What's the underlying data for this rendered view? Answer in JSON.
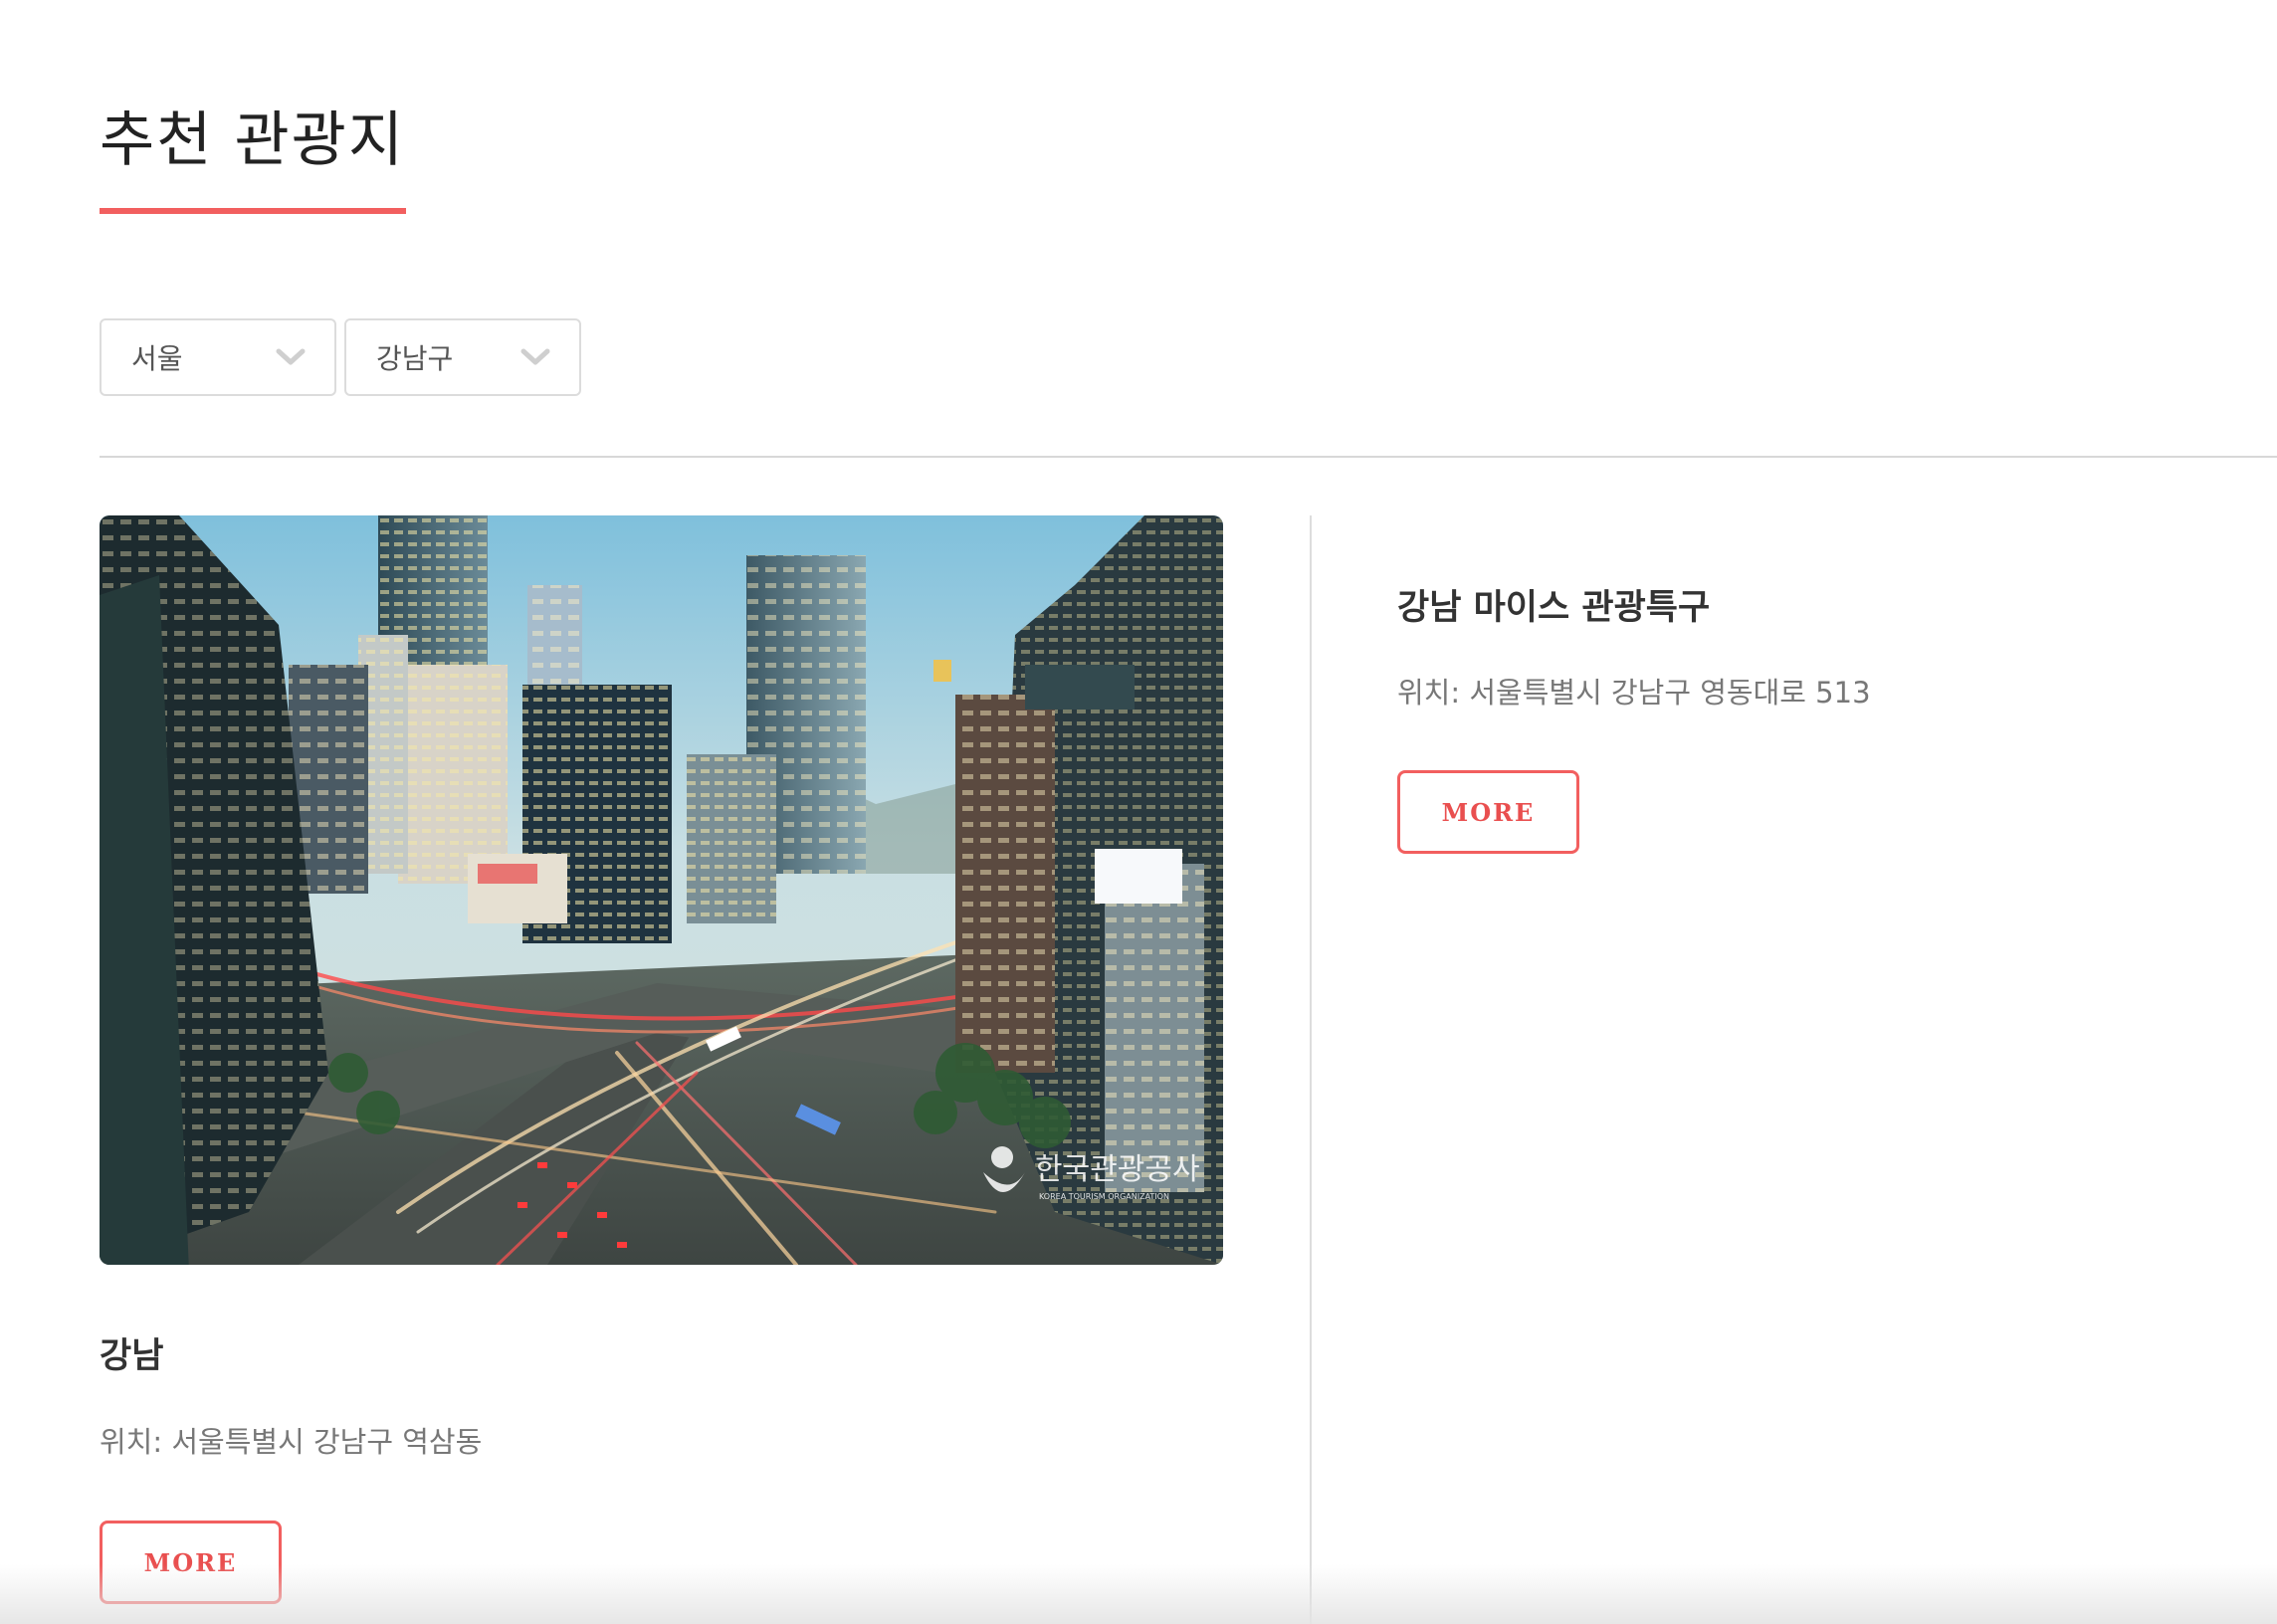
{
  "page": {
    "title": "추천 관광지",
    "accent_color": "#f25f5f"
  },
  "filters": {
    "region": {
      "value": "서울"
    },
    "district": {
      "value": "강남구"
    }
  },
  "cards": [
    {
      "title": "강남",
      "location": "위치: 서울특별시 강남구 역삼동",
      "button": "MORE",
      "image": {
        "description_icon": "city-photo",
        "watermark_korean": "한국관광공사",
        "watermark_english": "KOREA TOURISM ORGANIZATION"
      }
    },
    {
      "title": "강남 마이스 관광특구",
      "location": "위치: 서울특별시 강남구 영동대로 513",
      "button": "MORE"
    }
  ]
}
